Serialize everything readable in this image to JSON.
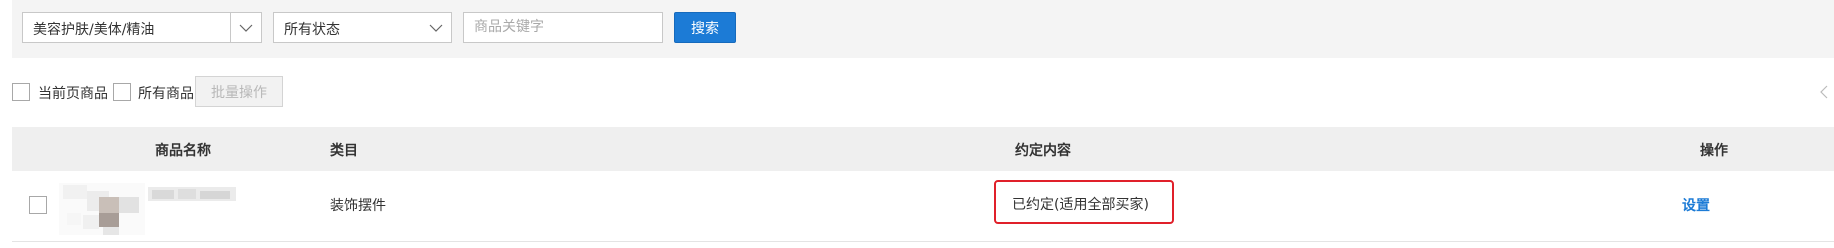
{
  "filters": {
    "category_value": "美容护肤/美体/精油",
    "status_value": "所有状态",
    "keyword_placeholder": "商品关键字",
    "keyword_value": "",
    "search_label": "搜索"
  },
  "selection": {
    "current_page_label": "当前页商品",
    "all_items_label": "所有商品",
    "batch_label": "批量操作"
  },
  "table": {
    "headers": {
      "name": "商品名称",
      "category": "类目",
      "agreement": "约定内容",
      "action": "操作"
    },
    "rows": [
      {
        "category": "装饰摆件",
        "agreement": "已约定(适用全部买家)",
        "action": "设置"
      }
    ]
  },
  "colors": {
    "accent": "#1c7bd6",
    "highlight_border": "#e0202a"
  }
}
